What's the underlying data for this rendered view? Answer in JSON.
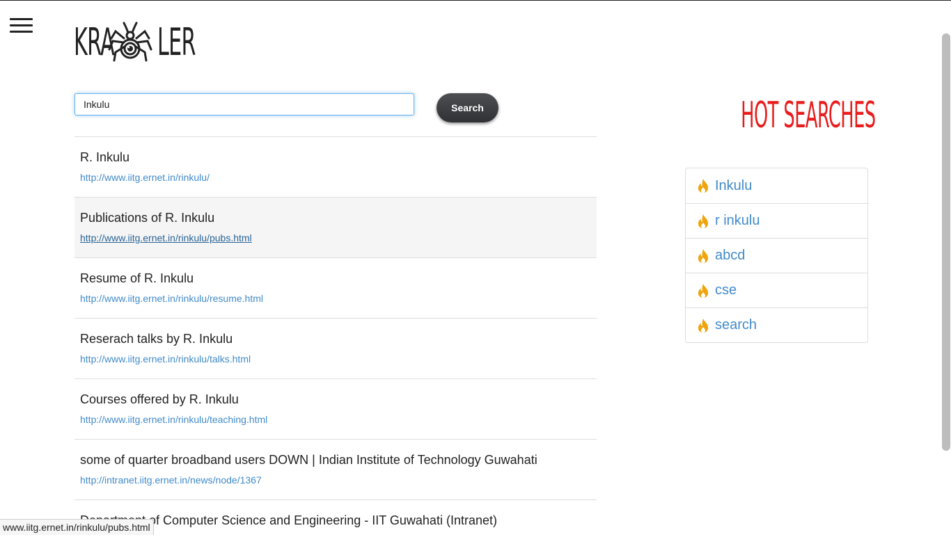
{
  "logo": {
    "left_text": "KRA",
    "right_text": "LER"
  },
  "search": {
    "value": "Inkulu",
    "button_label": "Search"
  },
  "results": [
    {
      "title": "R. Inkulu",
      "url": "http://www.iitg.ernet.in/rinkulu/"
    },
    {
      "title": "Publications of R. Inkulu",
      "url": "http://www.iitg.ernet.in/rinkulu/pubs.html"
    },
    {
      "title": "Resume of R. Inkulu",
      "url": "http://www.iitg.ernet.in/rinkulu/resume.html"
    },
    {
      "title": "Reserach talks by R. Inkulu",
      "url": "http://www.iitg.ernet.in/rinkulu/talks.html"
    },
    {
      "title": "Courses offered by R. Inkulu",
      "url": "http://www.iitg.ernet.in/rinkulu/teaching.html"
    },
    {
      "title": "some of quarter broadband users DOWN | Indian Institute of Technology Guwahati",
      "url": "http://intranet.iitg.ernet.in/news/node/1367"
    },
    {
      "title": "Department of Computer Science and Engineering - IIT Guwahati (Intranet)",
      "url": ""
    }
  ],
  "hot": {
    "title": "HOT SEARCHES",
    "icon": "fire-icon",
    "icon_color": "#f0a30a",
    "items": [
      "Inkulu",
      "r inkulu",
      "abcd",
      "cse",
      "search"
    ]
  },
  "status_bar": {
    "text": "www.iitg.ernet.in/rinkulu/pubs.html"
  },
  "colors": {
    "link": "#428bca",
    "hot_title": "#e81c1c",
    "button": "#3a3c40"
  }
}
